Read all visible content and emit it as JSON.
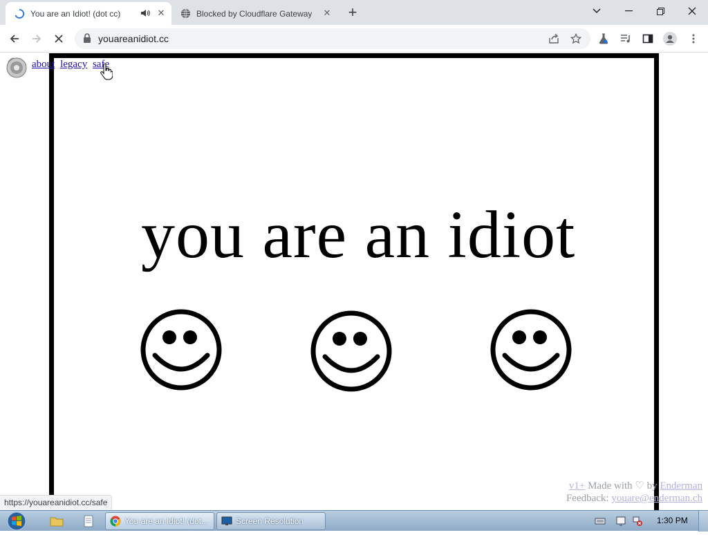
{
  "browser": {
    "tabs": [
      {
        "title": "You are an Idiot! (dot cc)",
        "active": true,
        "loading": true,
        "audio": true
      },
      {
        "title": "Blocked by Cloudflare Gateway",
        "active": false
      }
    ],
    "url": "youareanidiot.cc"
  },
  "page": {
    "links": {
      "about": "about",
      "legacy": "legacy",
      "safe": "safe"
    },
    "headline": "you are an idiot",
    "footer": {
      "version": "v1+",
      "made_with": "Made with",
      "heart": "♡",
      "by": "by",
      "author": "Enderman",
      "feedback_label": "Feedback:",
      "feedback_email": "youare@enderman.ch"
    },
    "status_url": "https://youareanidiot.cc/safe"
  },
  "taskbar": {
    "tasks": [
      {
        "label": "You are an Idiot! (dot..."
      },
      {
        "label": "Screen Resolution"
      }
    ],
    "clock": "1:30 PM"
  },
  "colors": {
    "tab_strip": "#dee1e6",
    "link": "#1a0dab",
    "frame": "#000000"
  }
}
